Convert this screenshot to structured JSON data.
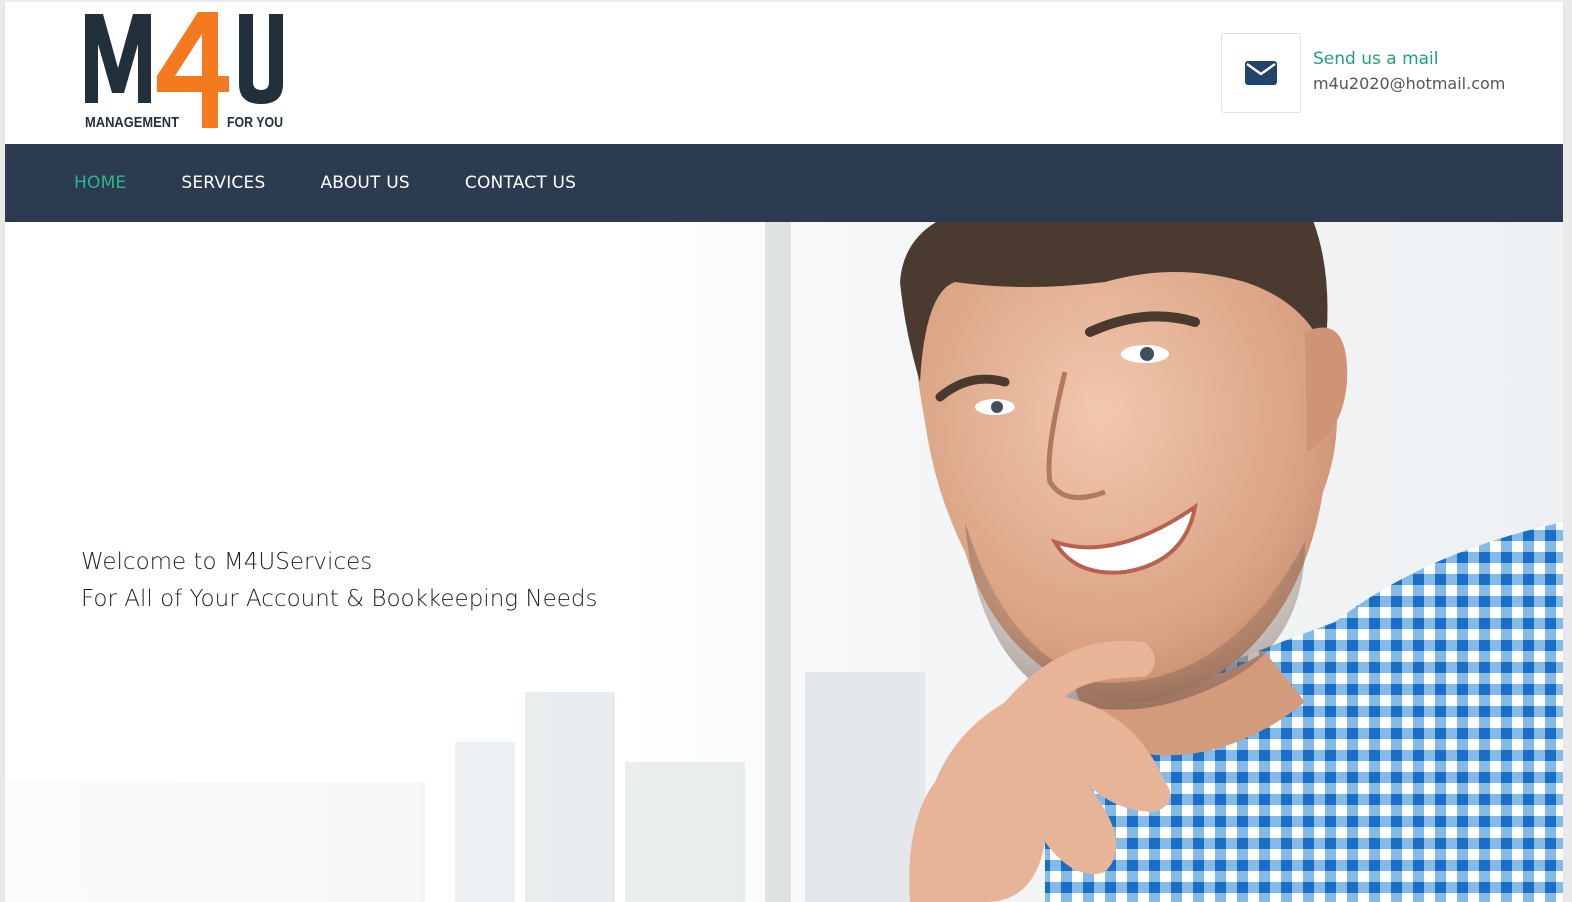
{
  "brand": {
    "logo_letters_left": "M",
    "logo_letter_accent": "4",
    "logo_letters_right": "U",
    "tagline_left": "MANAGEMENT",
    "tagline_right": "FOR YOU",
    "colors": {
      "dark": "#22303c",
      "accent": "#f47a20"
    }
  },
  "header": {
    "mail_icon": "envelope-icon",
    "contact_label": "Send us a mail",
    "contact_email": "m4u2020@hotmail.com"
  },
  "nav": {
    "items": [
      {
        "label": "HOME",
        "active": true
      },
      {
        "label": "SERVICES",
        "active": false
      },
      {
        "label": "ABOUT US",
        "active": false
      },
      {
        "label": "CONTACT US",
        "active": false
      }
    ],
    "colors": {
      "background": "#2c3b4f",
      "active": "#2cb68f",
      "text": "#ffffff"
    }
  },
  "hero": {
    "line1": "Welcome to M4UServices",
    "line2": "For All of Your Account & Bookkeeping Needs"
  }
}
